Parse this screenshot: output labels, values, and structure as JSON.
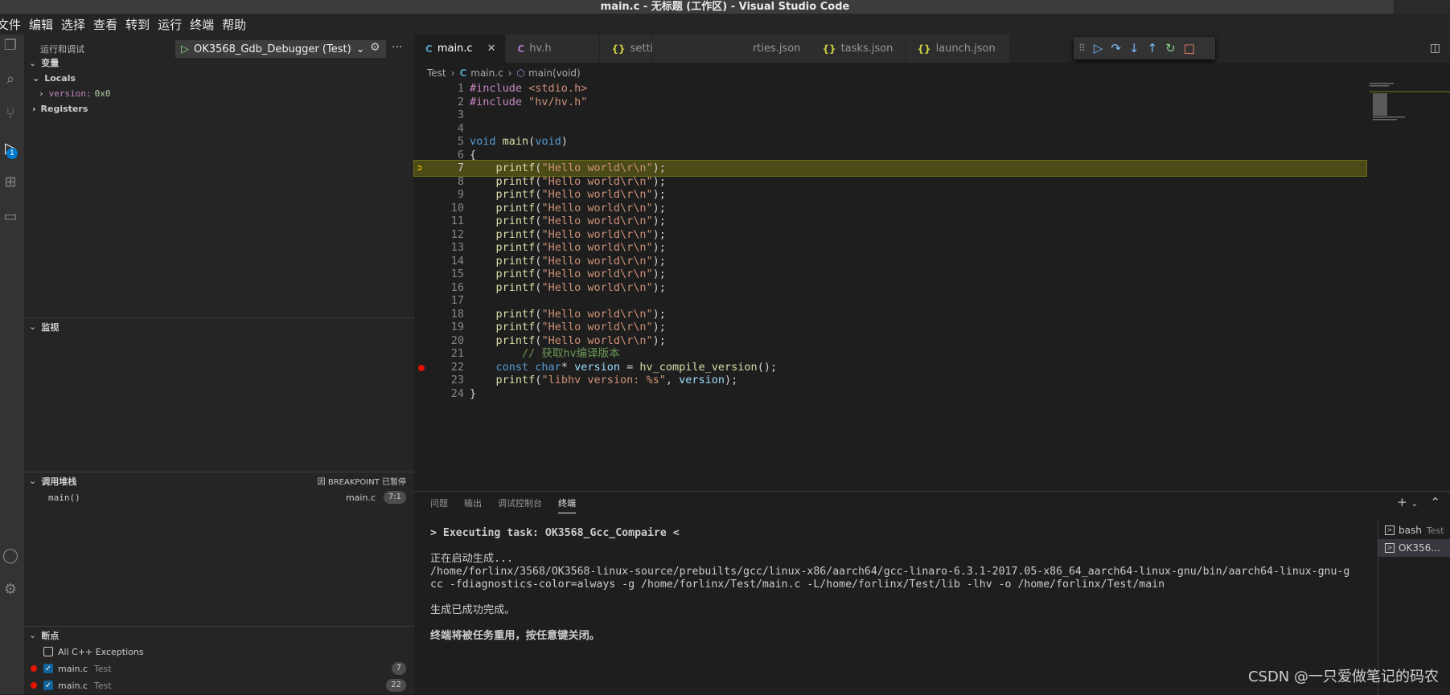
{
  "window": {
    "title": "main.c - 无标题 (工作区) - Visual Studio Code"
  },
  "menu": [
    "文件",
    "编辑",
    "选择",
    "查看",
    "转到",
    "运行",
    "终端",
    "帮助"
  ],
  "activity": {
    "badge": "1"
  },
  "sidebar": {
    "title": "运行和调试",
    "config": "OK3568_Gdb_Debugger (Test)",
    "variables": {
      "header": "变量",
      "locals_label": "Locals",
      "version_name": "version:",
      "version_value": "0x0",
      "registers_label": "Registers"
    },
    "watch": {
      "header": "监视"
    },
    "callstack": {
      "header": "调用堆栈",
      "status": "因 BREAKPOINT 已暂停",
      "frame_name": "main()",
      "frame_file": "main.c",
      "frame_pos": "7:1"
    },
    "breakpoints": {
      "header": "断点",
      "exceptions_label": "All C++ Exceptions",
      "items": [
        {
          "file": "main.c",
          "folder": "Test",
          "line": "7"
        },
        {
          "file": "main.c",
          "folder": "Test",
          "line": "22"
        }
      ]
    }
  },
  "editor": {
    "tabs": [
      {
        "label": "main.c",
        "kind": "C"
      },
      {
        "label": "hv.h",
        "kind": "C"
      },
      {
        "label": "setti",
        "kind": "{}"
      },
      {
        "label": "rties.json",
        "kind": ""
      },
      {
        "label": "tasks.json",
        "kind": "{}"
      },
      {
        "label": "launch.json",
        "kind": "{}"
      }
    ],
    "breadcrumb": {
      "folder": "Test",
      "file": "main.c",
      "symbol": "main(void)"
    },
    "lines": [
      {
        "n": "1",
        "t": "#include <stdio.h>"
      },
      {
        "n": "2",
        "t": "#include \"hv/hv.h\""
      },
      {
        "n": "3",
        "t": ""
      },
      {
        "n": "4",
        "t": ""
      },
      {
        "n": "5",
        "t": "void main(void)"
      },
      {
        "n": "6",
        "t": "{"
      },
      {
        "n": "7",
        "t": "    printf(\"Hello world\\r\\n\");"
      },
      {
        "n": "8",
        "t": "    printf(\"Hello world\\r\\n\");"
      },
      {
        "n": "9",
        "t": "    printf(\"Hello world\\r\\n\");"
      },
      {
        "n": "10",
        "t": "    printf(\"Hello world\\r\\n\");"
      },
      {
        "n": "11",
        "t": "    printf(\"Hello world\\r\\n\");"
      },
      {
        "n": "12",
        "t": "    printf(\"Hello world\\r\\n\");"
      },
      {
        "n": "13",
        "t": "    printf(\"Hello world\\r\\n\");"
      },
      {
        "n": "14",
        "t": "    printf(\"Hello world\\r\\n\");"
      },
      {
        "n": "15",
        "t": "    printf(\"Hello world\\r\\n\");"
      },
      {
        "n": "16",
        "t": "    printf(\"Hello world\\r\\n\");"
      },
      {
        "n": "17",
        "t": ""
      },
      {
        "n": "18",
        "t": "    printf(\"Hello world\\r\\n\");"
      },
      {
        "n": "19",
        "t": "    printf(\"Hello world\\r\\n\");"
      },
      {
        "n": "20",
        "t": "    printf(\"Hello world\\r\\n\");"
      },
      {
        "n": "21",
        "t": "        // 获取hv编译版本"
      },
      {
        "n": "22",
        "t": "    const char* version = hv_compile_version();"
      },
      {
        "n": "23",
        "t": "    printf(\"libhv version: %s\", version);"
      },
      {
        "n": "24",
        "t": "}"
      }
    ]
  },
  "panel": {
    "tabs": [
      "问题",
      "输出",
      "调试控制台",
      "终端"
    ],
    "terminal": {
      "task": "> Executing task: OK3568_Gcc_Compaire <",
      "starting": "正在启动生成...",
      "cmd1": "/home/forlinx/3568/OK3568-linux-source/prebuilts/gcc/linux-x86/aarch64/gcc-linaro-6.3.1-2017.05-x86_64_aarch64-linux-gnu/bin/aarch64-linux-gnu-g",
      "cmd2": "cc -fdiagnostics-color=always -g /home/forlinx/Test/main.c -L/home/forlinx/Test/lib -lhv -o /home/forlinx/Test/main",
      "done": "生成已成功完成。",
      "reuse": "终端将被任务重用，按任意键关闭。"
    },
    "terminals": [
      {
        "name": "bash",
        "folder": "Test"
      },
      {
        "name": "OK356...",
        "folder": ""
      }
    ]
  },
  "watermark": "CSDN @一只爱做笔记的码农"
}
